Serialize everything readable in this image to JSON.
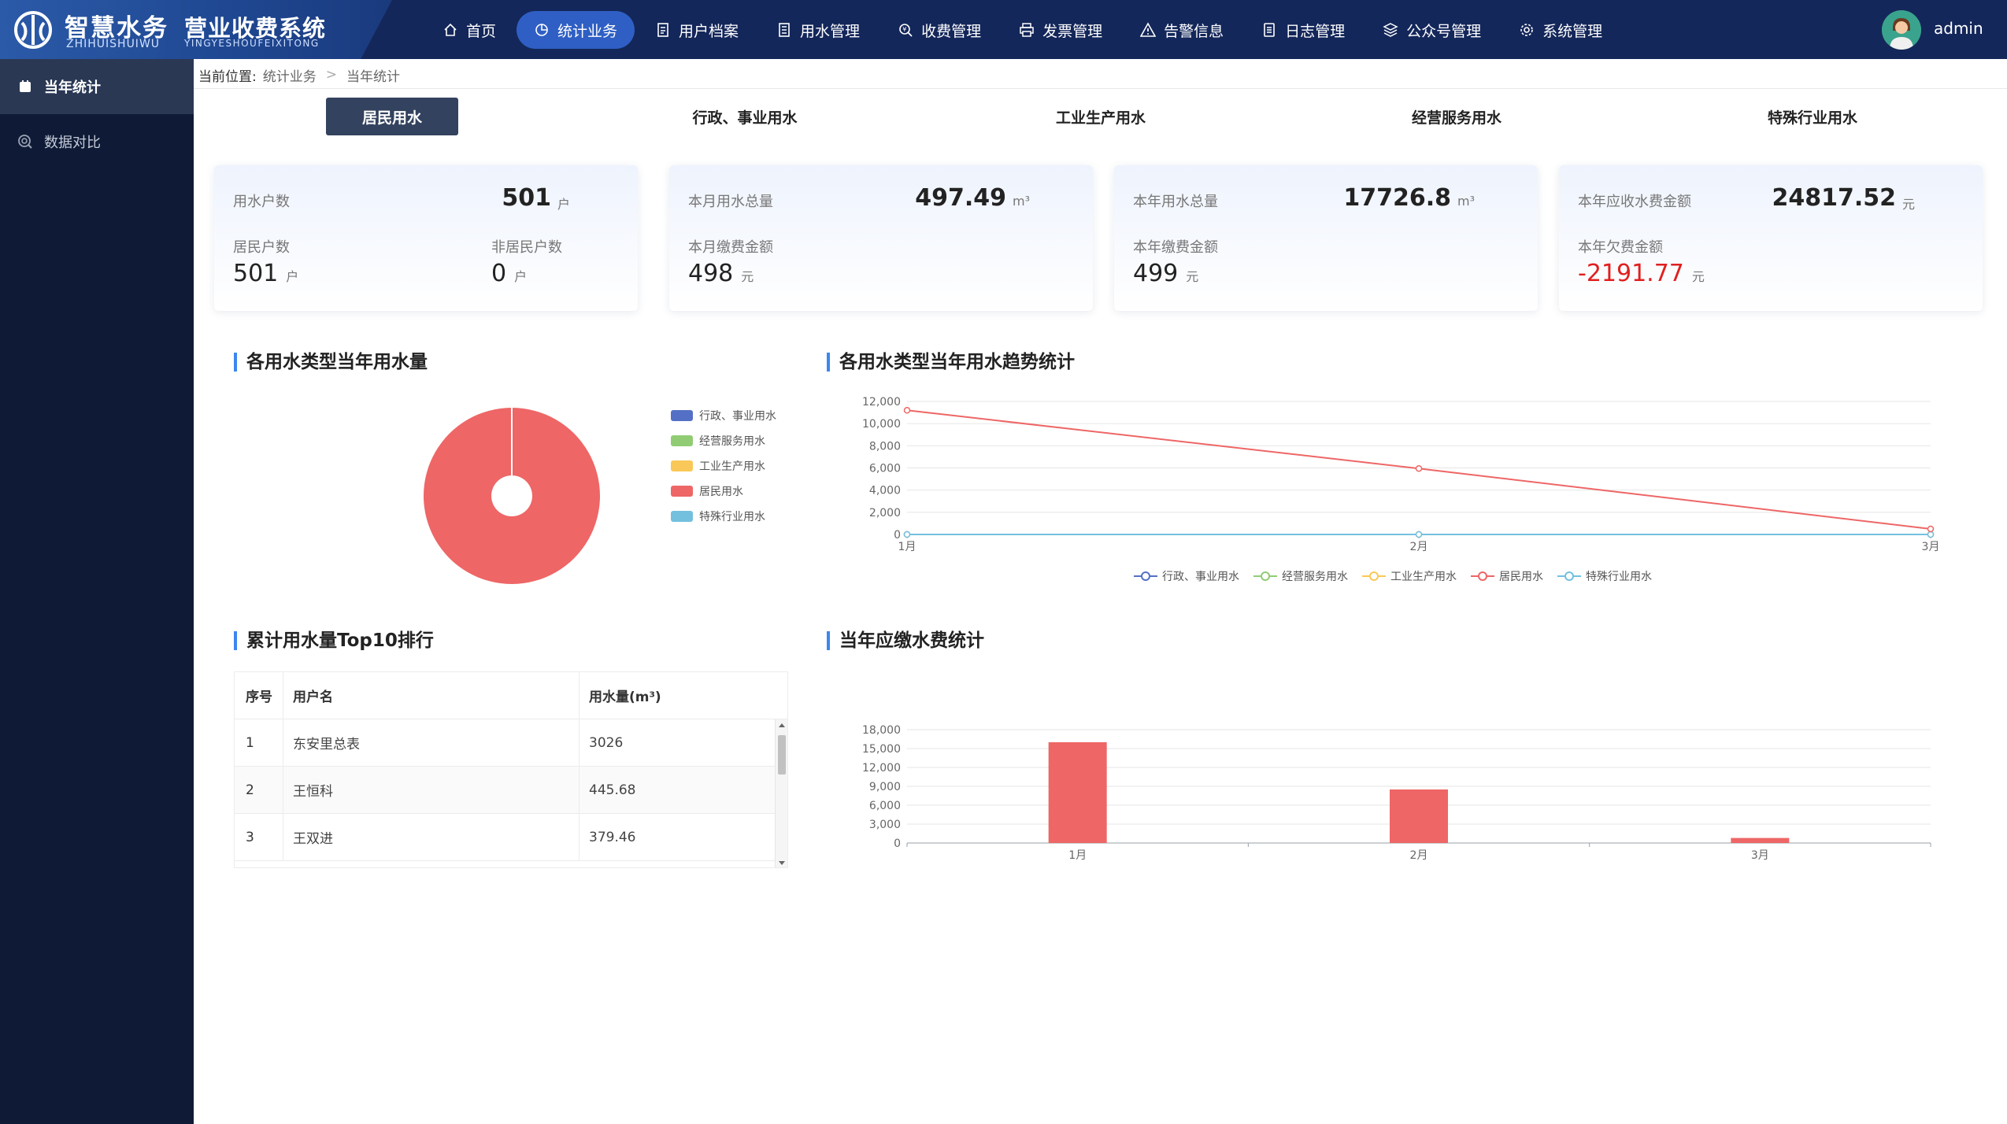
{
  "header": {
    "logo_cn": "智慧水务",
    "logo_en": "ZHIHUISHUIWU",
    "system_cn": "营业收费系统",
    "system_en": "YINGYESHOUFEIXITONG",
    "user": "admin"
  },
  "nav": [
    {
      "label": "首页",
      "icon": "home-icon"
    },
    {
      "label": "统计业务",
      "icon": "pie-chart-icon",
      "active": true
    },
    {
      "label": "用户档案",
      "icon": "file-icon"
    },
    {
      "label": "用水管理",
      "icon": "document-icon"
    },
    {
      "label": "收费管理",
      "icon": "search-money-icon"
    },
    {
      "label": "发票管理",
      "icon": "printer-icon"
    },
    {
      "label": "告警信息",
      "icon": "warning-icon"
    },
    {
      "label": "日志管理",
      "icon": "log-icon"
    },
    {
      "label": "公众号管理",
      "icon": "layers-icon"
    },
    {
      "label": "系统管理",
      "icon": "gear-icon"
    }
  ],
  "sidebar": [
    {
      "label": "当年统计",
      "icon": "calendar-icon",
      "active": true
    },
    {
      "label": "数据对比",
      "icon": "compare-icon"
    }
  ],
  "breadcrumb": {
    "label": "当前位置:",
    "items": [
      "统计业务",
      "当年统计"
    ]
  },
  "type_tabs": [
    "居民用水",
    "行政、事业用水",
    "工业生产用水",
    "经营服务用水",
    "特殊行业用水"
  ],
  "cards": [
    {
      "k1": "用水户数",
      "v1": "501",
      "u1": "户",
      "k2": "居民户数",
      "v2": "501",
      "u2": "户",
      "k3": "非居民户数",
      "v3": "0",
      "u3": "户"
    },
    {
      "k1": "本月用水总量",
      "v1": "497.49",
      "u1": "m³",
      "k2": "本月缴费金额",
      "v2": "498",
      "u2": "元"
    },
    {
      "k1": "本年用水总量",
      "v1": "17726.8",
      "u1": "m³",
      "k2": "本年缴费金额",
      "v2": "499",
      "u2": "元"
    },
    {
      "k1": "本年应收水费金额",
      "v1": "24817.52",
      "u1": "元",
      "k2": "本年欠费金额",
      "v2": "-2191.77",
      "u2": "元"
    }
  ],
  "sections": {
    "pie_title": "各用水类型当年用水量",
    "line_title": "各用水类型当年用水趋势统计",
    "table_title": "累计用水量Top10排行",
    "bar_title": "当年应缴水费统计"
  },
  "colors": {
    "行政、事业用水": "#5470c6",
    "经营服务用水": "#91cc75",
    "工业生产用水": "#fac858",
    "居民用水": "#ee6666",
    "特殊行业用水": "#73c0de"
  },
  "chart_data": [
    {
      "type": "pie",
      "categories": [
        "行政、事业用水",
        "经营服务用水",
        "工业生产用水",
        "居民用水",
        "特殊行业用水"
      ],
      "values": [
        0,
        0,
        0,
        17726.8,
        0
      ]
    },
    {
      "type": "line",
      "x": [
        "1月",
        "2月",
        "3月"
      ],
      "ylim": [
        0,
        12000
      ],
      "yticks": [
        "0",
        "2,000",
        "4,000",
        "6,000",
        "8,000",
        "10,000",
        "12,000"
      ],
      "series": [
        {
          "name": "行政、事业用水",
          "values": [
            0,
            0,
            0
          ]
        },
        {
          "name": "经营服务用水",
          "values": [
            0,
            0,
            0
          ]
        },
        {
          "name": "工业生产用水",
          "values": [
            0,
            0,
            0
          ]
        },
        {
          "name": "居民用水",
          "values": [
            11200,
            5950,
            500
          ]
        },
        {
          "name": "特殊行业用水",
          "values": [
            0,
            0,
            0
          ]
        }
      ]
    },
    {
      "type": "bar",
      "categories": [
        "1月",
        "2月",
        "3月"
      ],
      "values": [
        16000,
        8500,
        800
      ],
      "ylim": [
        0,
        18000
      ],
      "yticks": [
        "0",
        "3,000",
        "6,000",
        "9,000",
        "12,000",
        "15,000",
        "18,000"
      ]
    }
  ],
  "table": {
    "headers": [
      "序号",
      "用户名",
      "用水量(m³)"
    ],
    "rows": [
      [
        "1",
        "东安里总表",
        "3026"
      ],
      [
        "2",
        "王恒科",
        "445.68"
      ],
      [
        "3",
        "王双进",
        "379.46"
      ]
    ]
  }
}
